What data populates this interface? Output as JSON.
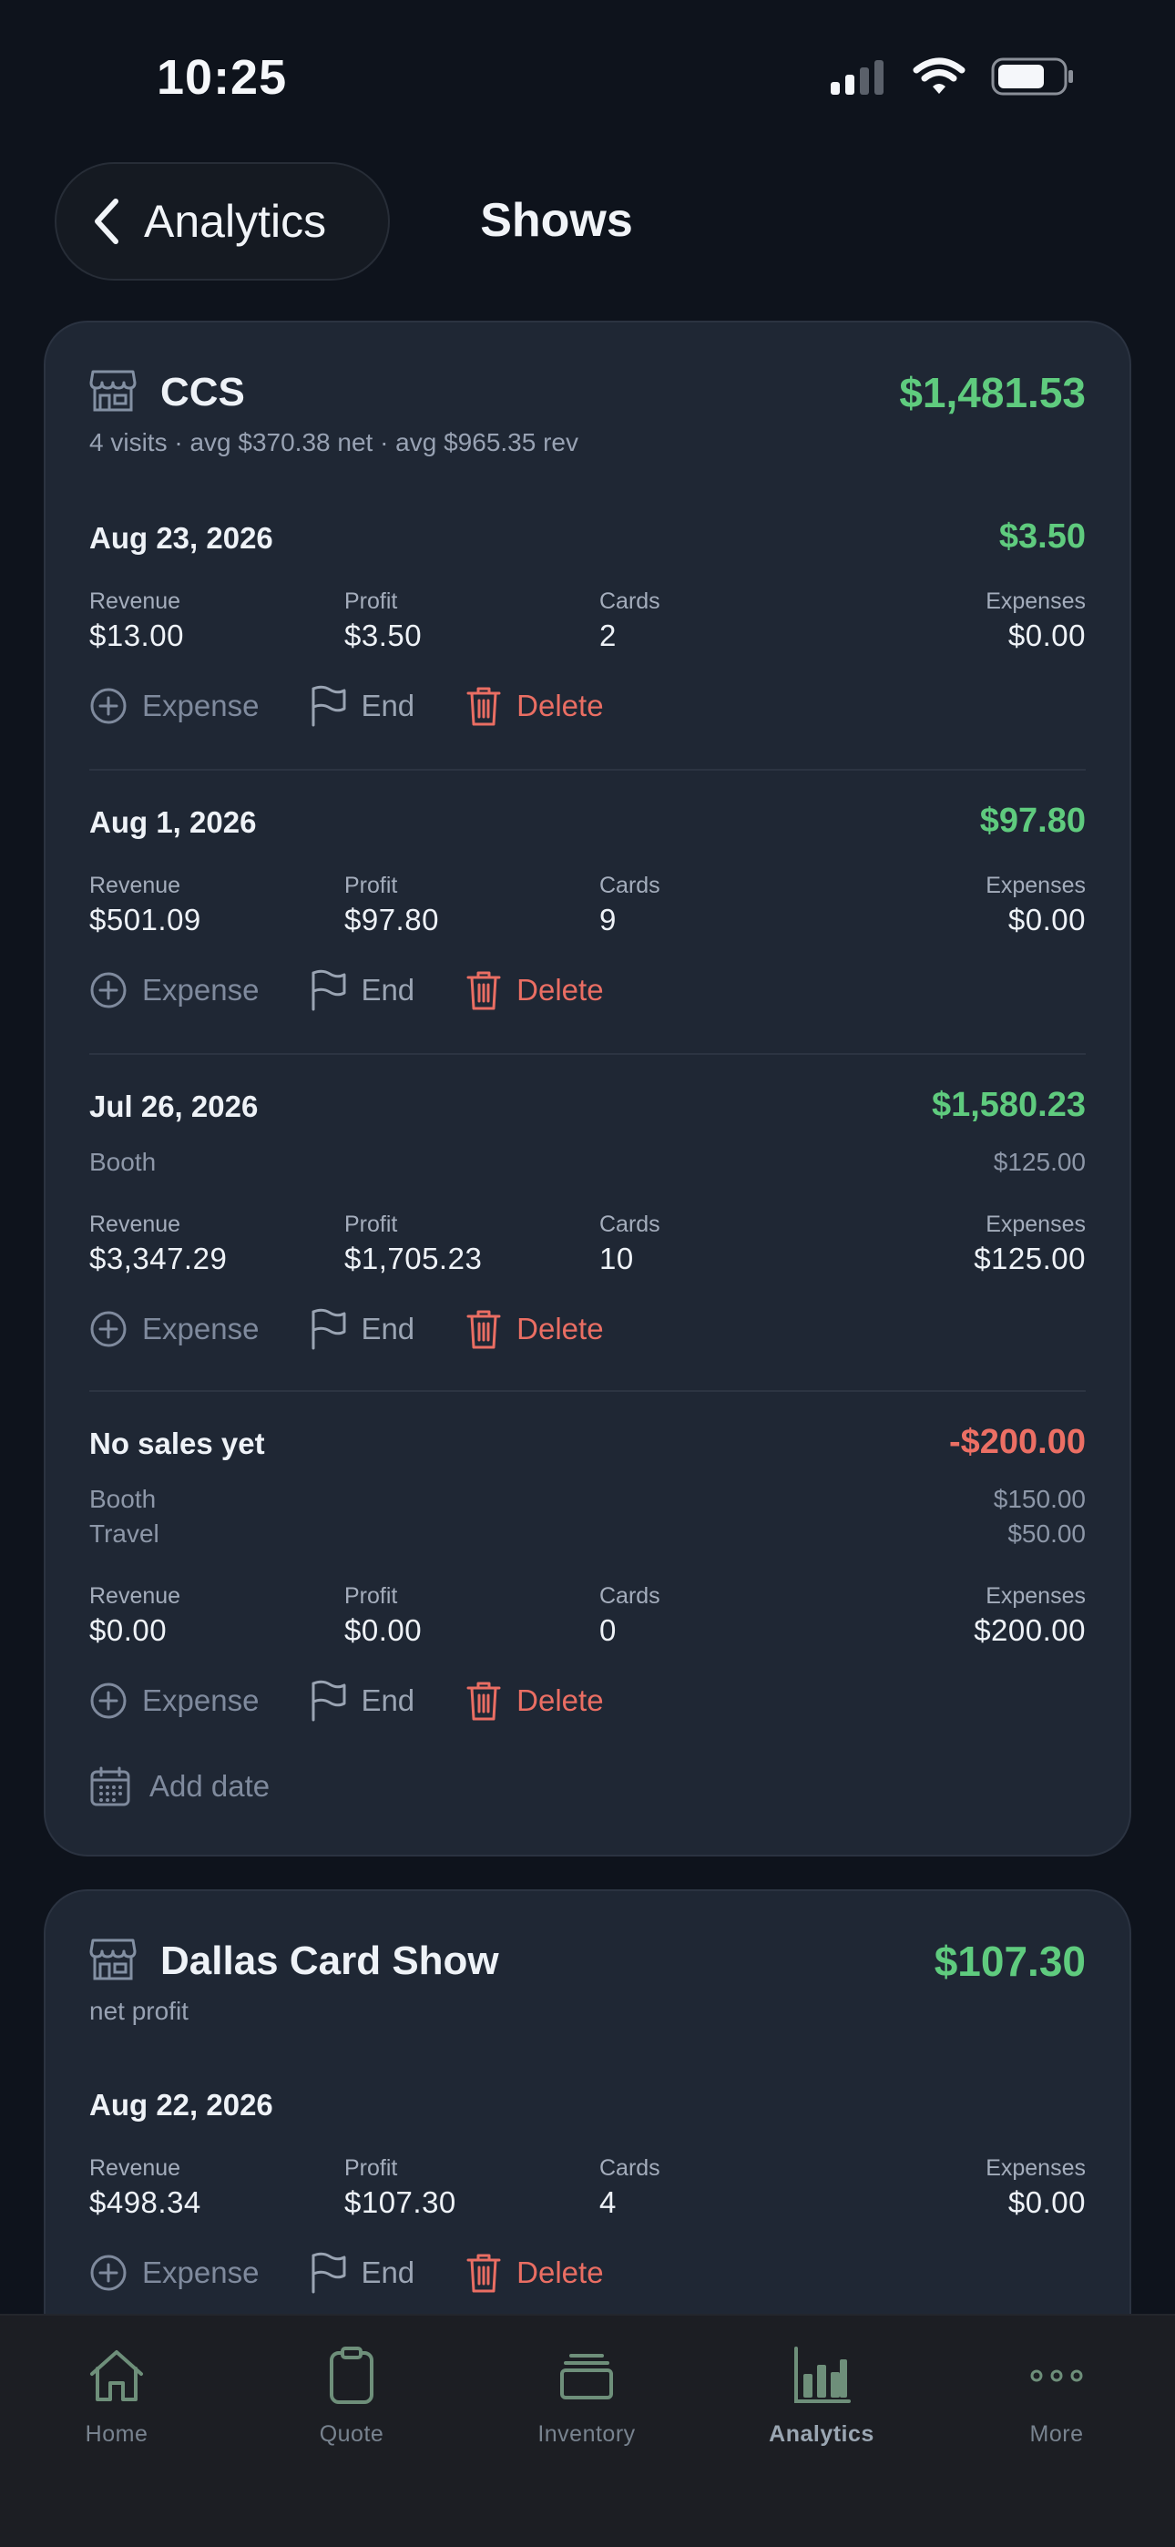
{
  "status": {
    "time": "10:25"
  },
  "header": {
    "back_label": "Analytics",
    "title": "Shows"
  },
  "shows": [
    {
      "name": "CCS",
      "total": "$1,481.53",
      "subtitle": "4 visits · avg $370.38 net · avg $965.35 rev",
      "visits": [
        {
          "date": "Aug 23, 2026",
          "amount": "$3.50",
          "revenue": "$13.00",
          "profit": "$3.50",
          "cards": "2",
          "expenses": "$0.00"
        },
        {
          "date": "Aug 1, 2026",
          "amount": "$97.80",
          "revenue": "$501.09",
          "profit": "$97.80",
          "cards": "9",
          "expenses": "$0.00"
        },
        {
          "date": "Jul 26, 2026",
          "amount": "$1,580.23",
          "expense_items": [
            {
              "name": "Booth",
              "value": "$125.00"
            }
          ],
          "revenue": "$3,347.29",
          "profit": "$1,705.23",
          "cards": "10",
          "expenses": "$125.00"
        },
        {
          "date": "No sales yet",
          "amount": "-$200.00",
          "expense_items": [
            {
              "name": "Booth",
              "value": "$150.00"
            },
            {
              "name": "Travel",
              "value": "$50.00"
            }
          ],
          "revenue": "$0.00",
          "profit": "$0.00",
          "cards": "0",
          "expenses": "$200.00"
        }
      ],
      "add_date": "Add date"
    },
    {
      "name": "Dallas Card Show",
      "total": "$107.30",
      "subtitle": "net profit",
      "visits": [
        {
          "date": "Aug 22, 2026",
          "amount": "$107.30",
          "revenue": "$498.34",
          "profit": "$107.30",
          "cards": "4",
          "expenses": "$0.00"
        }
      ]
    }
  ],
  "labels": {
    "revenue": "Revenue",
    "profit": "Profit",
    "cards": "Cards",
    "expenses": "Expenses",
    "expense_action": "Expense",
    "end_action": "End",
    "delete_action": "Delete"
  },
  "tabs": [
    {
      "label": "Home",
      "icon": "home-icon"
    },
    {
      "label": "Quote",
      "icon": "clipboard-icon"
    },
    {
      "label": "Inventory",
      "icon": "stack-icon"
    },
    {
      "label": "Analytics",
      "icon": "bar-chart-icon",
      "active": true
    },
    {
      "label": "More",
      "icon": "more-icon"
    }
  ],
  "colors": {
    "positive": "#5fcb7e",
    "negative": "#ec6f64",
    "card_bg": "#1f2734",
    "page_bg": "#0e131c",
    "tab_accent": "#6e8f7a"
  }
}
